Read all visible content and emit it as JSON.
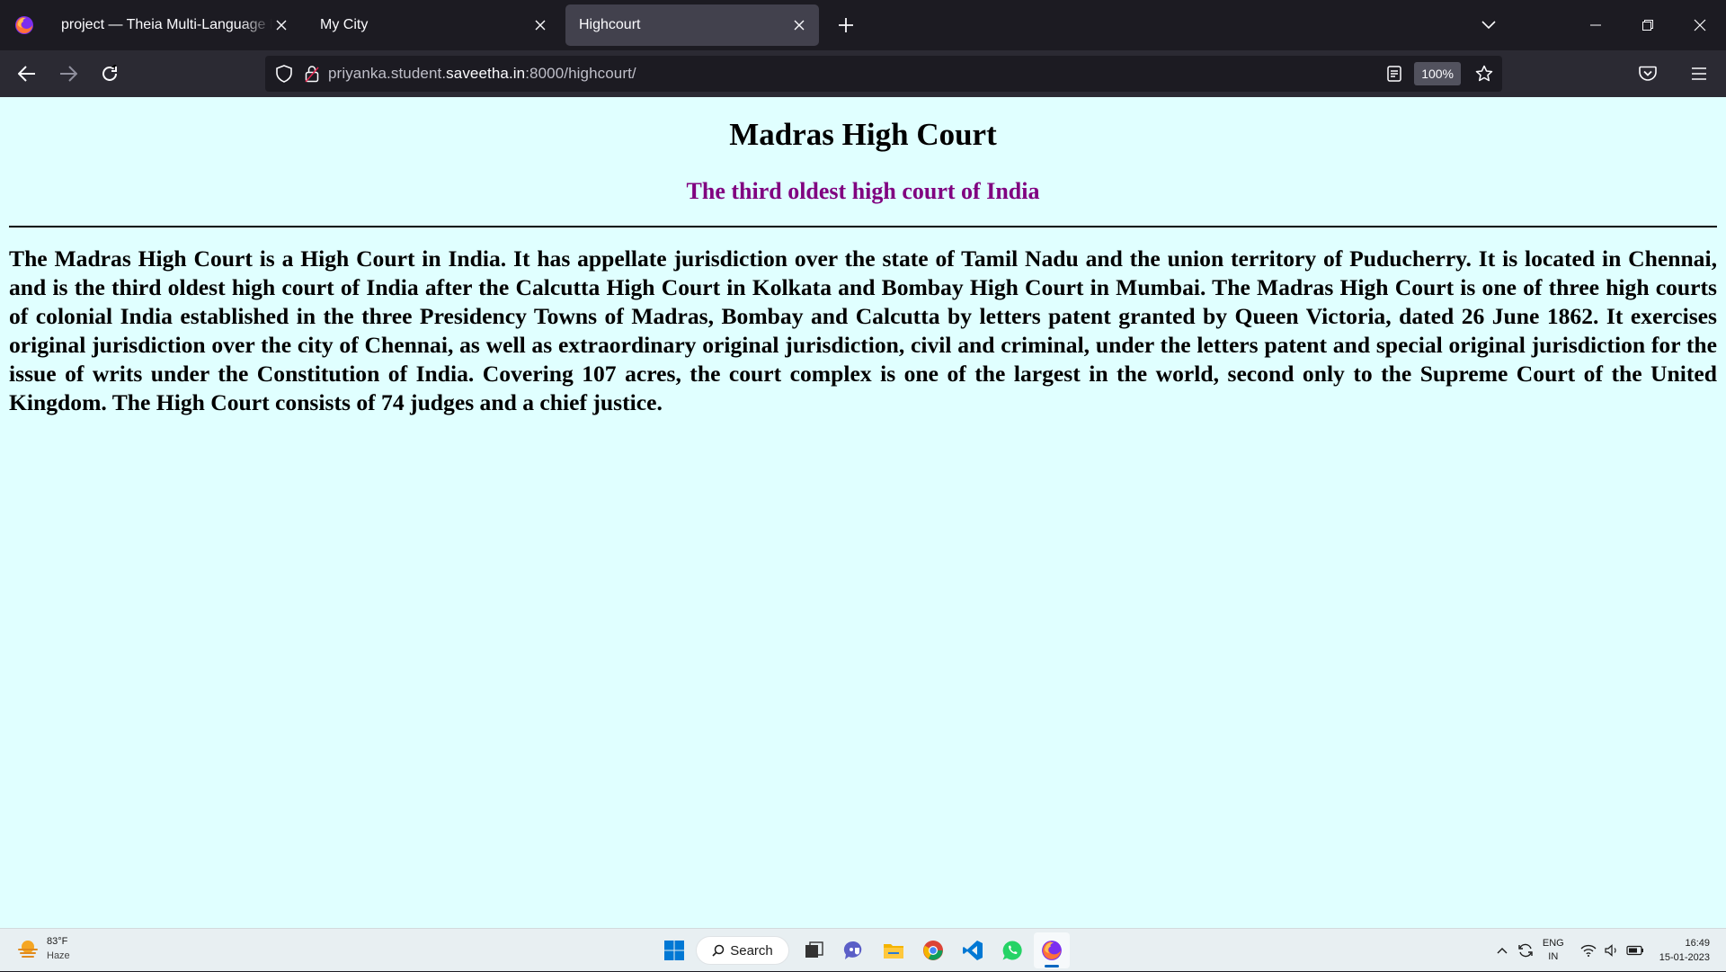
{
  "browser": {
    "tabs": [
      {
        "title": "project — Theia Multi-Language Example",
        "active": false
      },
      {
        "title": "My City",
        "active": false
      },
      {
        "title": "Highcourt",
        "active": true
      }
    ],
    "url": {
      "prefix": "priyanka.student.",
      "host": "saveetha.in",
      "suffix": ":8000/highcourt/"
    },
    "zoom": "100%"
  },
  "page": {
    "title": "Madras High Court",
    "subtitle": "The third oldest high court of India",
    "body": "The Madras High Court is a High Court in India. It has appellate jurisdiction over the state of Tamil Nadu and the union territory of Puducherry. It is located in Chennai, and is the third oldest high court of India after the Calcutta High Court in Kolkata and Bombay High Court in Mumbai. The Madras High Court is one of three high courts of colonial India established in the three Presidency Towns of Madras, Bombay and Calcutta by letters patent granted by Queen Victoria, dated 26 June 1862. It exercises original jurisdiction over the city of Chennai, as well as extraordinary original jurisdiction, civil and criminal, under the letters patent and special original jurisdiction for the issue of writs under the Constitution of India. Covering 107 acres, the court complex is one of the largest in the world, second only to the Supreme Court of the United Kingdom. The High Court consists of 74 judges and a chief justice.",
    "colors": {
      "background": "#e0ffff",
      "subtitle": "#800080"
    }
  },
  "taskbar": {
    "weather": {
      "temp": "83°F",
      "condition": "Haze"
    },
    "search_label": "Search",
    "lang": {
      "line1": "ENG",
      "line2": "IN"
    },
    "clock": {
      "time": "16:49",
      "date": "15-01-2023"
    }
  }
}
